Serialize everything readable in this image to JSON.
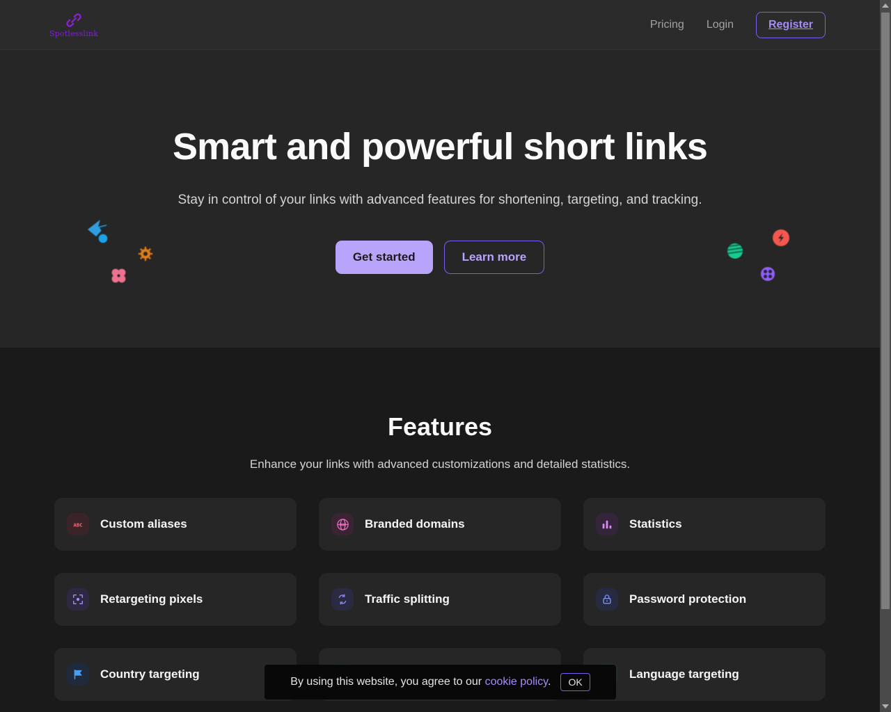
{
  "header": {
    "brand_name": "Spotlesslink",
    "brand_icon": "chain-link-icon",
    "nav": [
      {
        "label": "Pricing",
        "name": "nav-pricing"
      },
      {
        "label": "Login",
        "name": "nav-login"
      }
    ],
    "register_label": "Register"
  },
  "hero": {
    "title": "Smart and powerful short links",
    "subtitle": "Stay in control of your links with advanced features for shortening, targeting, and tracking.",
    "primary_cta": "Get started",
    "secondary_cta": "Learn more",
    "decorations": [
      {
        "name": "blue-arrow-decoration",
        "color": "#2f9ee0"
      },
      {
        "name": "blue-dot-decoration",
        "color": "#1aa3e8"
      },
      {
        "name": "orange-sunburst-decoration",
        "color": "#e07b18"
      },
      {
        "name": "pink-flower-decoration",
        "color": "#f07090"
      },
      {
        "name": "green-striped-circle-decoration",
        "color": "#19c98f"
      },
      {
        "name": "red-lightning-circle-decoration",
        "color": "#f2584f"
      },
      {
        "name": "purple-dots-circle-decoration",
        "color": "#9061f9"
      }
    ]
  },
  "features": {
    "title": "Features",
    "subtitle": "Enhance your links with advanced customizations and detailed statistics.",
    "cards": [
      {
        "label": "Custom aliases",
        "icon": "abc-icon",
        "icon_color": "#f2697c",
        "icon_bg": "#3b2428"
      },
      {
        "label": "Branded domains",
        "icon": "www-globe-icon",
        "icon_color": "#f06ec0",
        "icon_bg": "#3a2433"
      },
      {
        "label": "Statistics",
        "icon": "bar-chart-icon",
        "icon_color": "#d98cf5",
        "icon_bg": "#34253c"
      },
      {
        "label": "Retargeting pixels",
        "icon": "target-focus-icon",
        "icon_color": "#a78bfa",
        "icon_bg": "#2e2940"
      },
      {
        "label": "Traffic splitting",
        "icon": "split-refresh-icon",
        "icon_color": "#8b8cf7",
        "icon_bg": "#2a2a42"
      },
      {
        "label": "Password protection",
        "icon": "lock-icon",
        "icon_color": "#7f93f8",
        "icon_bg": "#262b42"
      },
      {
        "label": "Country targeting",
        "icon": "flag-icon",
        "icon_color": "#4a9ef0",
        "icon_bg": "#1f2b3d"
      },
      {
        "label": "",
        "icon": "hidden-icon",
        "icon_color": "#3da9a0",
        "icon_bg": "#1d2e30"
      },
      {
        "label": "Language targeting",
        "icon": "translate-icon",
        "icon_color": "#3db8a8",
        "icon_bg": "#1d2f31"
      }
    ]
  },
  "cookie_banner": {
    "text_before": "By using this website, you agree to our",
    "link_label": "cookie policy",
    "text_after": ".",
    "ok_label": "OK"
  },
  "scrollbar": {
    "up_arrow": "scroll-up-arrow",
    "down_arrow": "scroll-down-arrow"
  }
}
